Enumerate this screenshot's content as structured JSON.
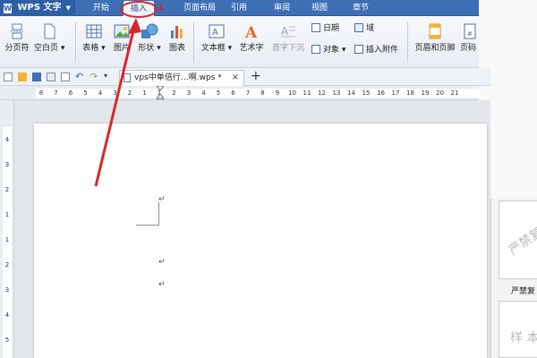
{
  "app": {
    "name": "WPS 文字",
    "logo": "W"
  },
  "menu_tabs": [
    "开始",
    "插入",
    "页面布局",
    "引用",
    "审阅",
    "视图",
    "章节"
  ],
  "active_tab": "插入",
  "ribbon": {
    "page_break": "分页符",
    "blank_page": "空白页",
    "table": "表格",
    "picture": "图片",
    "shape": "形状",
    "chart": "图表",
    "textbox": "文本框",
    "wordart": "艺术字",
    "dropcap": "首字下沉",
    "date": "日期",
    "field": "域",
    "object": "对象",
    "attachment": "插入附件",
    "header_footer": "页眉和页脚",
    "page_num": "页码"
  },
  "doc_tab": {
    "name": "vps中单倍行…啊.wps *",
    "close": "×"
  },
  "ruler_numbers": [
    "8",
    "7",
    "6",
    "5",
    "4",
    "3",
    "2",
    "1",
    "1",
    "2",
    "3",
    "4",
    "5",
    "6",
    "7",
    "8",
    "9",
    "10",
    "11",
    "12",
    "13",
    "14",
    "15",
    "16",
    "17",
    "18",
    "19",
    "20",
    "21"
  ],
  "vruler_numbers": [
    "4",
    "3",
    "2",
    "1",
    "1",
    "2",
    "3",
    "4",
    "5"
  ],
  "document": {
    "para_mark": "↵"
  },
  "side_panel": {
    "watermark_text": "严禁复",
    "label": "严禁复",
    "sample_text": "样 本"
  },
  "annotation": {
    "number": "1"
  },
  "colors": {
    "menubar": "#3d6fb5",
    "annotation": "#d9262b"
  }
}
